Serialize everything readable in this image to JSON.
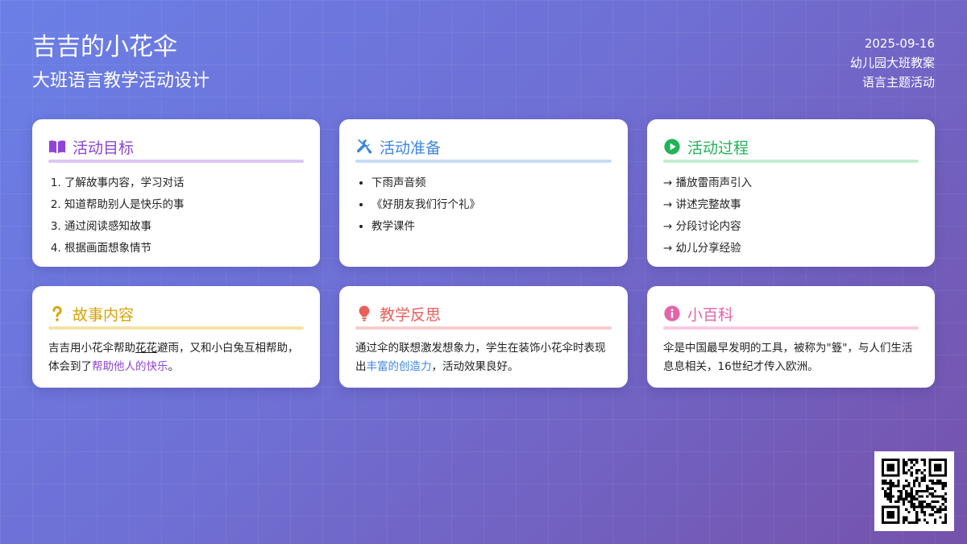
{
  "header": {
    "title": "吉吉的小花伞",
    "subtitle": "大班语言教学活动设计",
    "date": "2025-09-16",
    "meta_line1": "幼儿园大班教案",
    "meta_line2": "语言主题活动"
  },
  "colors": {
    "goals": "#8e44d6",
    "prep": "#3a86e0",
    "process": "#22b358",
    "story": "#d9a20a",
    "reflection": "#e9605a",
    "encyclopedia": "#e563a8"
  },
  "cards": {
    "goals": {
      "icon": "book-icon",
      "title": "活动目标",
      "items": [
        "了解故事内容，学习对话",
        "知道帮助别人是快乐的事",
        "通过阅读感知故事",
        "根据画面想象情节"
      ]
    },
    "prep": {
      "icon": "tools-icon",
      "title": "活动准备",
      "items": [
        "下雨声音频",
        "《好朋友我们行个礼》",
        "教学课件"
      ]
    },
    "process": {
      "icon": "play-icon",
      "title": "活动过程",
      "items": [
        "→ 播放雷雨声引入",
        "→ 讲述完整故事",
        "→ 分段讨论内容",
        "→ 幼儿分享经验"
      ]
    },
    "story": {
      "icon": "question-icon",
      "title": "故事内容",
      "text_a": "吉吉用小花伞帮助",
      "text_underlined": "花花",
      "text_b": "避雨，又和小白兔互相帮助，体会到了",
      "text_highlight": "帮助他人的快乐",
      "text_c": "。"
    },
    "reflection": {
      "icon": "lightbulb-icon",
      "title": "教学反思",
      "text_a": "通过伞的联想激发想象力，学生在装饰小花伞时表现出",
      "text_highlight": "丰富的创造力",
      "text_b": "，活动效果良好。"
    },
    "encyclopedia": {
      "icon": "info-icon",
      "title": "小百科",
      "text": "伞是中国最早发明的工具，被称为\"簦\"，与人们生活息息相关，16世纪才传入欧洲。"
    }
  }
}
